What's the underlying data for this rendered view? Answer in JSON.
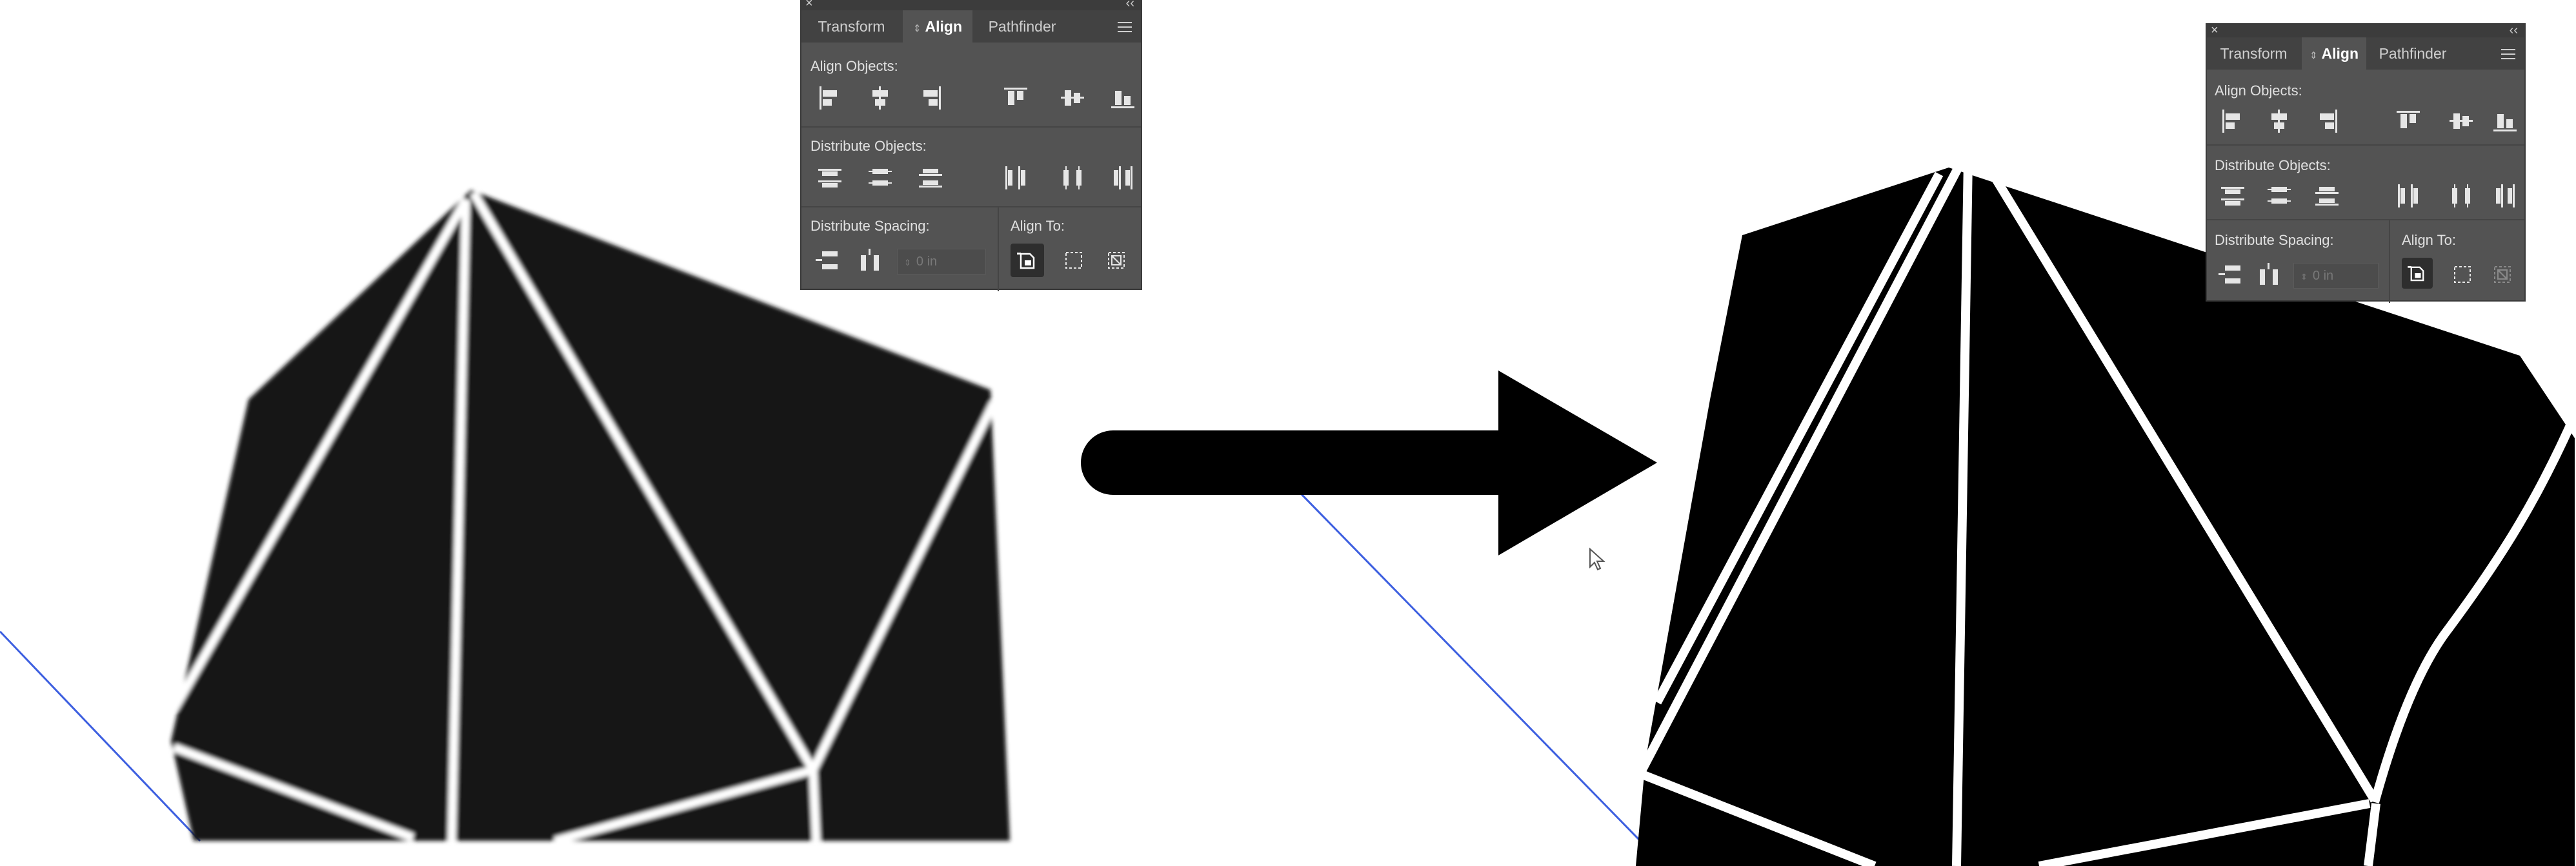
{
  "panels": [
    {
      "tabs": {
        "transform": "Transform",
        "align": "Align",
        "pathfinder": "Pathfinder"
      },
      "sections": {
        "align_objects": "Align Objects:",
        "distribute_objects": "Distribute Objects:",
        "distribute_spacing": "Distribute Spacing:",
        "align_to": "Align To:"
      },
      "spacing_value": "0 in"
    },
    {
      "tabs": {
        "transform": "Transform",
        "align": "Align",
        "pathfinder": "Pathfinder"
      },
      "sections": {
        "align_objects": "Align Objects:",
        "distribute_objects": "Distribute Objects:",
        "distribute_spacing": "Distribute Spacing:",
        "align_to": "Align To:"
      },
      "spacing_value": "0 in"
    }
  ],
  "icons": {
    "close": "close-icon",
    "collapse": "double-chevron-icon",
    "menu": "panel-menu-icon",
    "arrow": "right-arrow-icon",
    "cursor": "mouse-pointer-icon"
  },
  "colors": {
    "canvas": "#ffffff",
    "artwork_fill": "#151515",
    "facet_lines": "#ffffff",
    "guide_line": "#3d5fe0",
    "panel_bg": "#535353",
    "panel_header": "#424242"
  }
}
